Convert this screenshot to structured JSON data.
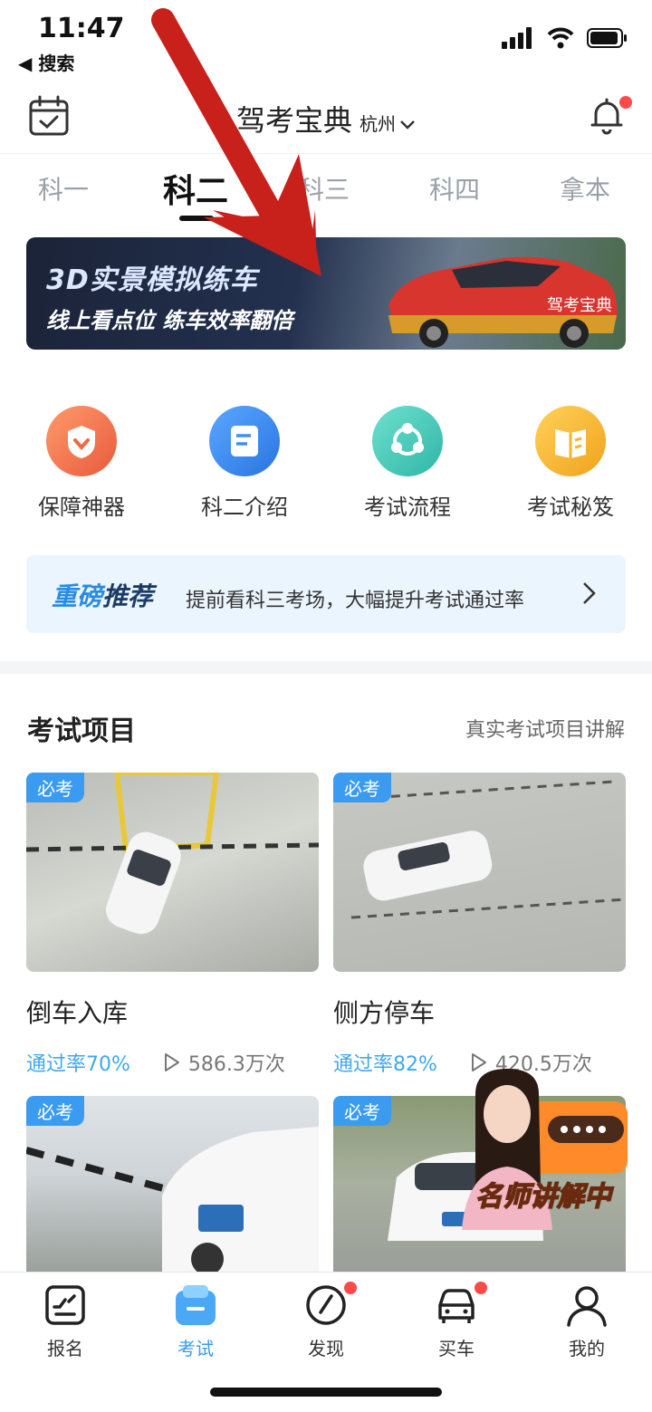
{
  "status_bar": {
    "time": "11:47",
    "back_label": "◀ 搜索"
  },
  "header": {
    "title": "驾考宝典",
    "city": "杭州"
  },
  "tabs": [
    {
      "label": "科一"
    },
    {
      "label": "科二"
    },
    {
      "label": "科三"
    },
    {
      "label": "科四"
    },
    {
      "label": "拿本"
    }
  ],
  "banner": {
    "title": "3D实景模拟练车",
    "subtitle": "线上看点位  练车效率翻倍",
    "car_text": "驾考宝典"
  },
  "entries": [
    {
      "label": "保障神器",
      "icon": "shield-heart-icon",
      "color": "#f3704f"
    },
    {
      "label": "科二介绍",
      "icon": "document-icon",
      "color": "#3d8ff0"
    },
    {
      "label": "考试流程",
      "icon": "flow-icon",
      "color": "#46c7b8"
    },
    {
      "label": "考试秘笈",
      "icon": "book-icon",
      "color": "#f5b52a"
    }
  ],
  "recommend": {
    "tag_a": "重磅",
    "tag_b": "推荐",
    "text": "提前看科三考场，大幅提升考试通过率"
  },
  "section": {
    "title": "考试项目",
    "link": "真实考试项目讲解"
  },
  "cards": [
    {
      "badge": "必考",
      "name": "倒车入库",
      "pass": "通过率70%",
      "views": "586.3万次"
    },
    {
      "badge": "必考",
      "name": "侧方停车",
      "pass": "通过率82%",
      "views": "420.5万次"
    },
    {
      "badge": "必考"
    },
    {
      "badge": "必考"
    }
  ],
  "teacher": {
    "label": "名师讲解中"
  },
  "bottom_nav": [
    {
      "label": "报名"
    },
    {
      "label": "考试"
    },
    {
      "label": "发现"
    },
    {
      "label": "买车"
    },
    {
      "label": "我的"
    }
  ],
  "colors": {
    "accent": "#3b9bf1",
    "notification": "#ff4a4a",
    "arrow": "#c8201b"
  }
}
